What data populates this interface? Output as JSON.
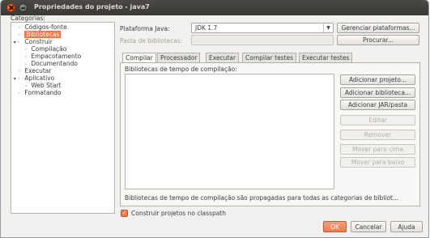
{
  "window": {
    "title": "Propriedades do projeto - java7"
  },
  "categories": {
    "label": "Categorias:",
    "items": [
      {
        "sym": "◦",
        "label": "Códigos-fonte",
        "indent": 1
      },
      {
        "sym": "◦",
        "label": "Bibliotecas",
        "indent": 1,
        "selected": true
      },
      {
        "sym": "▾ ◦",
        "label": "Construir",
        "indent": 0
      },
      {
        "sym": "◦",
        "label": "Compilação",
        "indent": 2
      },
      {
        "sym": "◦",
        "label": "Empacotamento",
        "indent": 2
      },
      {
        "sym": "◦",
        "label": "Documentando",
        "indent": 2
      },
      {
        "sym": "◦",
        "label": "Executar",
        "indent": 1
      },
      {
        "sym": "▾ ◦",
        "label": "Aplicativo",
        "indent": 0
      },
      {
        "sym": "◦",
        "label": "Web Start",
        "indent": 2
      },
      {
        "sym": "◦",
        "label": "Formatando",
        "indent": 1
      }
    ]
  },
  "platform": {
    "label": "Plataforma Java:",
    "value": "JDK 1.7",
    "manage_button": "Gerenciar plataformas..."
  },
  "libfolder": {
    "label": "Pasta de bibliotecas:",
    "value": "",
    "browse_button": "Procurar..."
  },
  "tabs": [
    "Compilar",
    "Processador",
    "Executar",
    "Compilar testes",
    "Executar testes"
  ],
  "active_tab": "Compilar",
  "compile": {
    "list_label": "Bibliotecas de tempo de compilação:",
    "buttons": {
      "add_project": "Adicionar projeto...",
      "add_library": "Adicionar biblioteca...",
      "add_jar": "Adicionar JAR/pasta",
      "edit": "Editar",
      "remove": "Remover",
      "move_up": "Mover para cima",
      "move_down": "Mover para baixo"
    },
    "note": "Bibliotecas de tempo de compilação são propagadas para todas as categorias de bibliot..."
  },
  "build_on_classpath": {
    "label": "Construir projetos no classpath",
    "checked": true
  },
  "footer": {
    "ok": "OK",
    "cancel": "Cancelar",
    "help": "Ajuda"
  },
  "colors": {
    "accent": "#f07746",
    "titlebar": "#3c3b37"
  }
}
